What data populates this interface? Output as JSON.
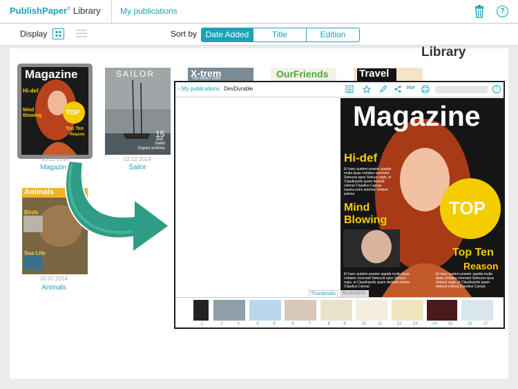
{
  "header": {
    "brand_name": "PublishPaper",
    "brand_reg": "®",
    "brand_suffix": "Library",
    "nav_link": "My publications",
    "help_label": "?"
  },
  "toolbar": {
    "display_label": "Display",
    "sort_label": "Sort by",
    "sort_options": [
      "Date Added",
      "Title",
      "Edition"
    ],
    "sort_selected": "Date Added"
  },
  "library_heading": "Library",
  "publications": [
    {
      "title": "Magazine",
      "date": "03.12.2014"
    },
    {
      "title": "Sailor",
      "date": "02.12.2014"
    },
    {
      "title": "X-trem",
      "date": ""
    },
    {
      "title": "OurFriends",
      "date": ""
    },
    {
      "title": "Travel",
      "date": ""
    },
    {
      "title": "Animals",
      "date": "30.07.2014"
    }
  ],
  "covers": {
    "magazine": {
      "masthead": "Magazine",
      "hidef": "Hi-def",
      "mind": "Mind",
      "blowing": "Blowing",
      "top": "TOP",
      "topten": "Top Ten",
      "reason": "Reason",
      "body1": "Et hanc quidem praeter oppida multa duae civitates exornant Seleucia opus Seleuci regis, et Claudiopolis quam deduxit colonia Claudius Caesar. Isauria enim antehac nimium potens.",
      "body2": "Et hanc quidem praeter oppida multa duae civitates exornant Seleucia opus Seleuci regis, et Claudiopolis quam deduxit colonia Claudius Caesar."
    },
    "sailor": {
      "masthead": "SAILOR",
      "big": "15",
      "line1": "ANS",
      "line2": "Sailor",
      "line3": "Expert en/time"
    },
    "xtrem": {
      "masthead": "X-trem",
      "sub": "The bikers code"
    },
    "ourfriends": {
      "masthead": "OurFriends"
    },
    "travel": {
      "masthead": "Travel"
    },
    "animals": {
      "masthead": "Animals",
      "birds": "Birds",
      "sealife": "Sea Life"
    }
  },
  "reader": {
    "back_label": "My publications",
    "doc_title": "DevDurable",
    "pdf_label": "PDF",
    "help_label": "?",
    "thumbs_tab": "Thumbnails",
    "bookmarks_tab": "Bookmarks",
    "page_numbers": [
      "1",
      "2",
      "3",
      "4",
      "5",
      "6",
      "7",
      "8",
      "9",
      "10",
      "11",
      "12",
      "13",
      "14",
      "15",
      "16",
      "17"
    ]
  },
  "colors": {
    "accent": "#1aa3b7",
    "cover_yellow": "#f5cc00",
    "arrow_green": "#2f9d85"
  }
}
